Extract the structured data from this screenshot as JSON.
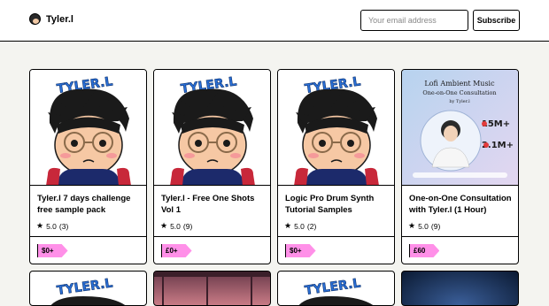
{
  "header": {
    "brand_name": "Tyler.l",
    "email_placeholder": "Your email address",
    "subscribe_label": "Subscribe"
  },
  "products": [
    {
      "title": "Tyler.l 7 days challenge free sample pack",
      "rating": "5.0",
      "reviews": "(3)",
      "price": "$0+",
      "thumb": "avatar-illustration"
    },
    {
      "title": "Tyler.l - Free One Shots Vol 1",
      "rating": "5.0",
      "reviews": "(9)",
      "price": "£0+",
      "thumb": "avatar-illustration"
    },
    {
      "title": "Logic Pro Drum Synth Tutorial Samples",
      "rating": "5.0",
      "reviews": "(2)",
      "price": "$0+",
      "thumb": "avatar-illustration"
    },
    {
      "title": "One-on-One Consultation with Tyler.l (1 Hour)",
      "rating": "5.0",
      "reviews": "(9)",
      "price": "£60",
      "thumb": "consultation-poster"
    }
  ],
  "poster": {
    "line1": "Lofi Ambient Music",
    "line2": "One-on-One Consultation",
    "line3": "by Tyler.l",
    "stat1": "15M+",
    "stat2": "2.1M+"
  },
  "thumb_logo": "TYLER.L",
  "colors": {
    "price_tag": "#ff90e8",
    "poster_bg": "#c9ddf0"
  }
}
